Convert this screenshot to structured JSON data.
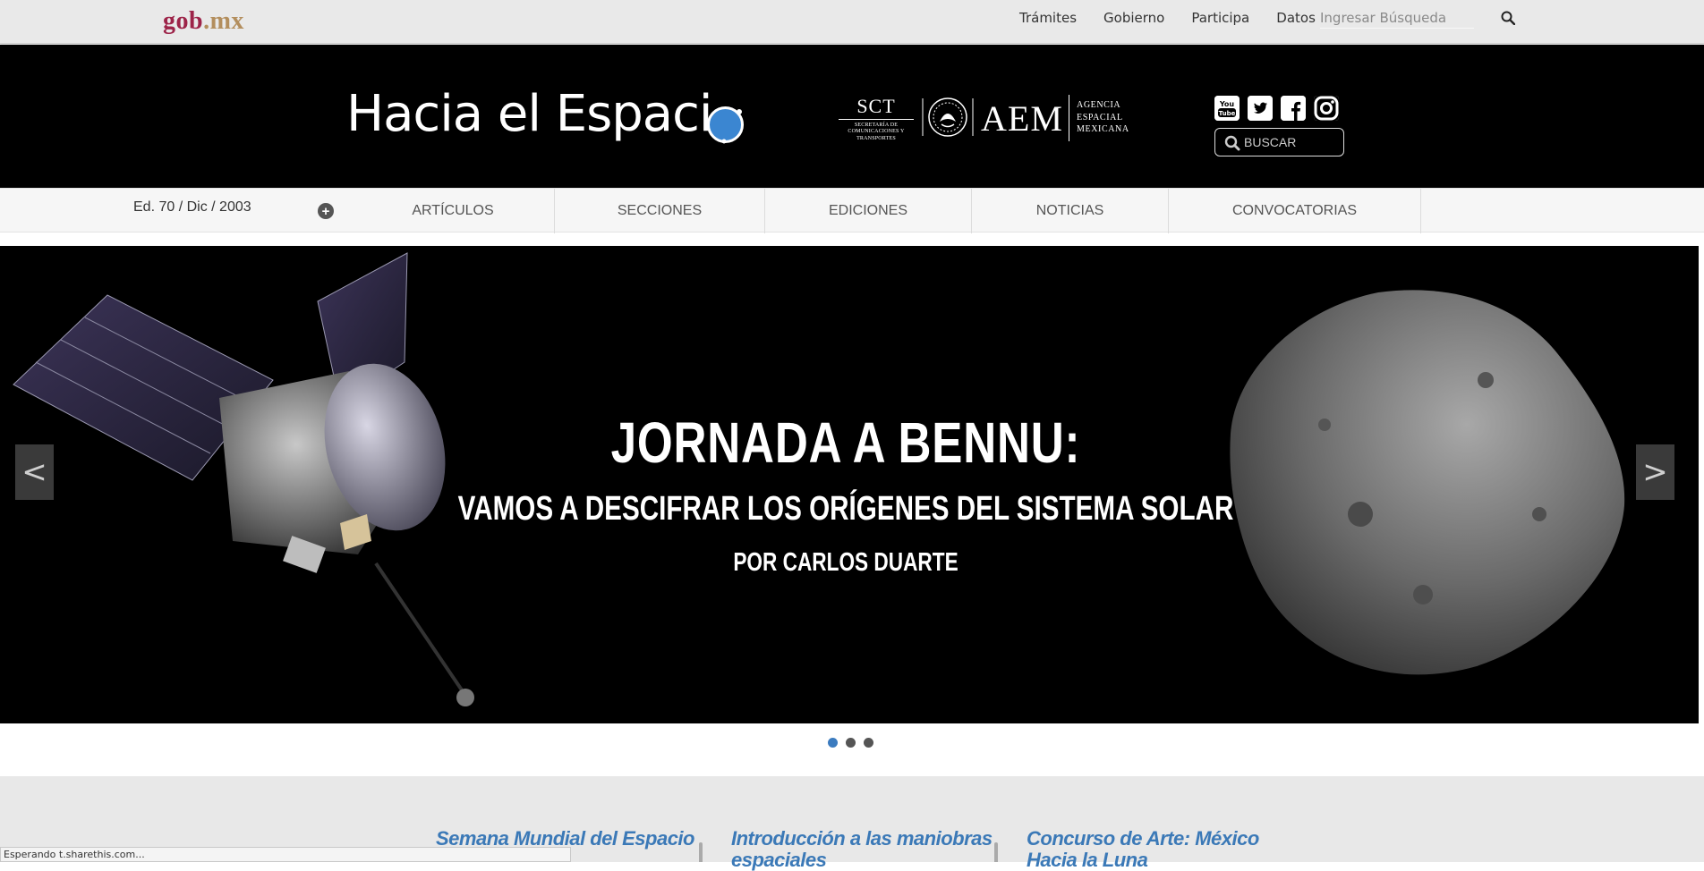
{
  "gob_bar": {
    "logo_part1": "gob",
    "logo_part2": ".mx",
    "nav": [
      "Trámites",
      "Gobierno",
      "Participa",
      "Datos"
    ],
    "search_placeholder": "Ingresar Búsqueda",
    "search_icon": "search-icon"
  },
  "header": {
    "site_title": "Hacia el Espaci",
    "sct_label": "SCT",
    "sct_subtitle": "SECRETARÍA DE COMUNICACIONES Y TRANSPORTES",
    "aem_label": "AEM",
    "aem_subtitle_lines": [
      "AGENCIA",
      "ESPACIAL",
      "MEXICANA"
    ],
    "social_icons": [
      "youtube-icon",
      "twitter-icon",
      "facebook-icon",
      "instagram-icon"
    ],
    "search_placeholder": "BUSCAR",
    "accent_color": "#3b86d1"
  },
  "subnav": {
    "edition": "Ed. 70 / Dic / 2003",
    "items": [
      "ARTÍCULOS",
      "SECCIONES",
      "EDICIONES",
      "NOTICIAS",
      "CONVOCATORIAS"
    ]
  },
  "hero": {
    "headline": "JORNADA A BENNU:",
    "subheadline": "VAMOS A DESCIFRAR LOS ORÍGENES DEL SISTEMA SOLAR",
    "byline": "POR CARLOS DUARTE",
    "prev_label": "<",
    "next_label": ">",
    "slide_count": 3,
    "active_slide": 1
  },
  "cards": [
    {
      "title": "Semana Mundial del Espacio"
    },
    {
      "title": "Introducción a las maniobras espaciales"
    },
    {
      "title": "Concurso de Arte: México Hacia la Luna"
    }
  ],
  "status_bar": {
    "text": "Esperando t.sharethis.com..."
  }
}
